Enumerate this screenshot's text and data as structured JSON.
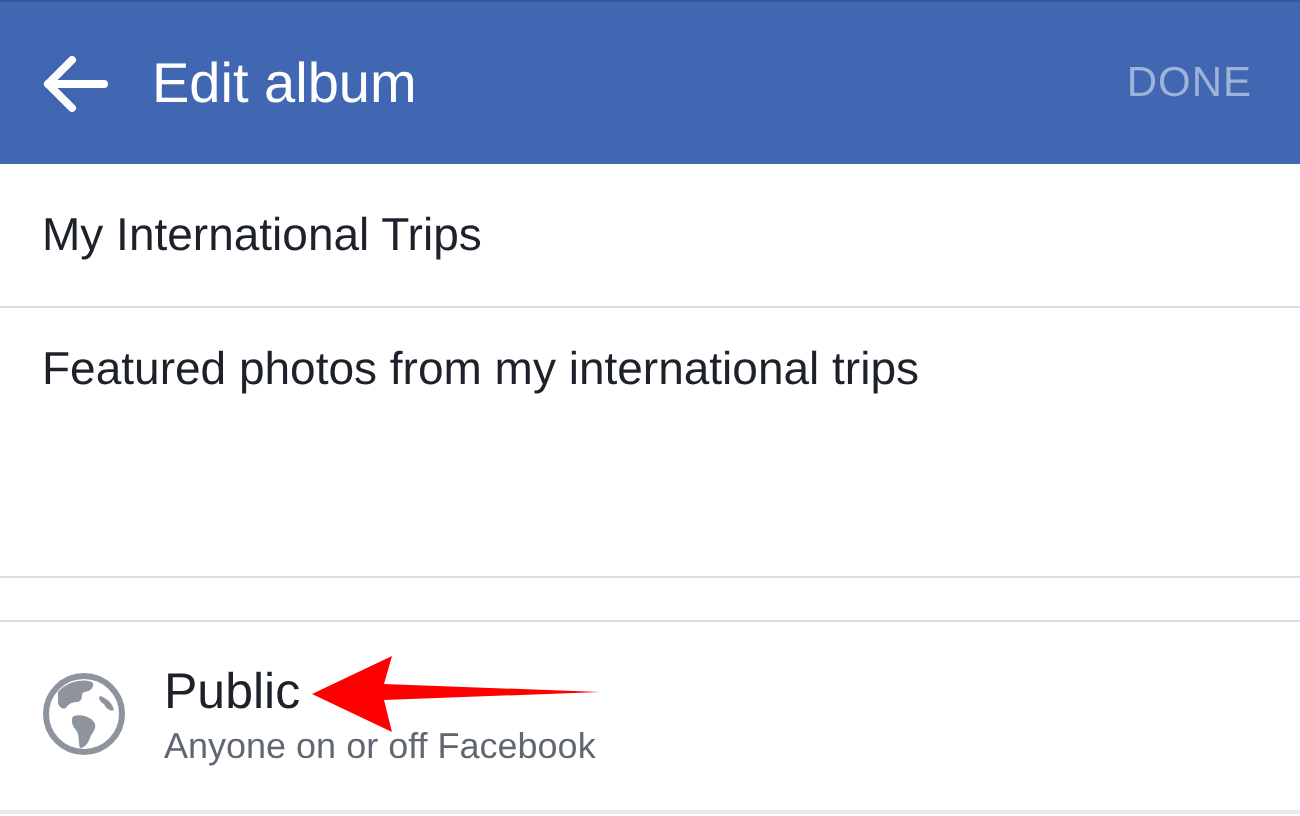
{
  "app_bar": {
    "title": "Edit album",
    "action": {
      "label": "DONE",
      "disabled": true
    }
  },
  "fields": [
    {
      "kind": "name",
      "value": "My International Trips"
    },
    {
      "kind": "description",
      "value": "Featured photos from my international trips"
    }
  ],
  "privacy": {
    "label": "Public",
    "description": "Anyone on or off Facebook"
  }
}
